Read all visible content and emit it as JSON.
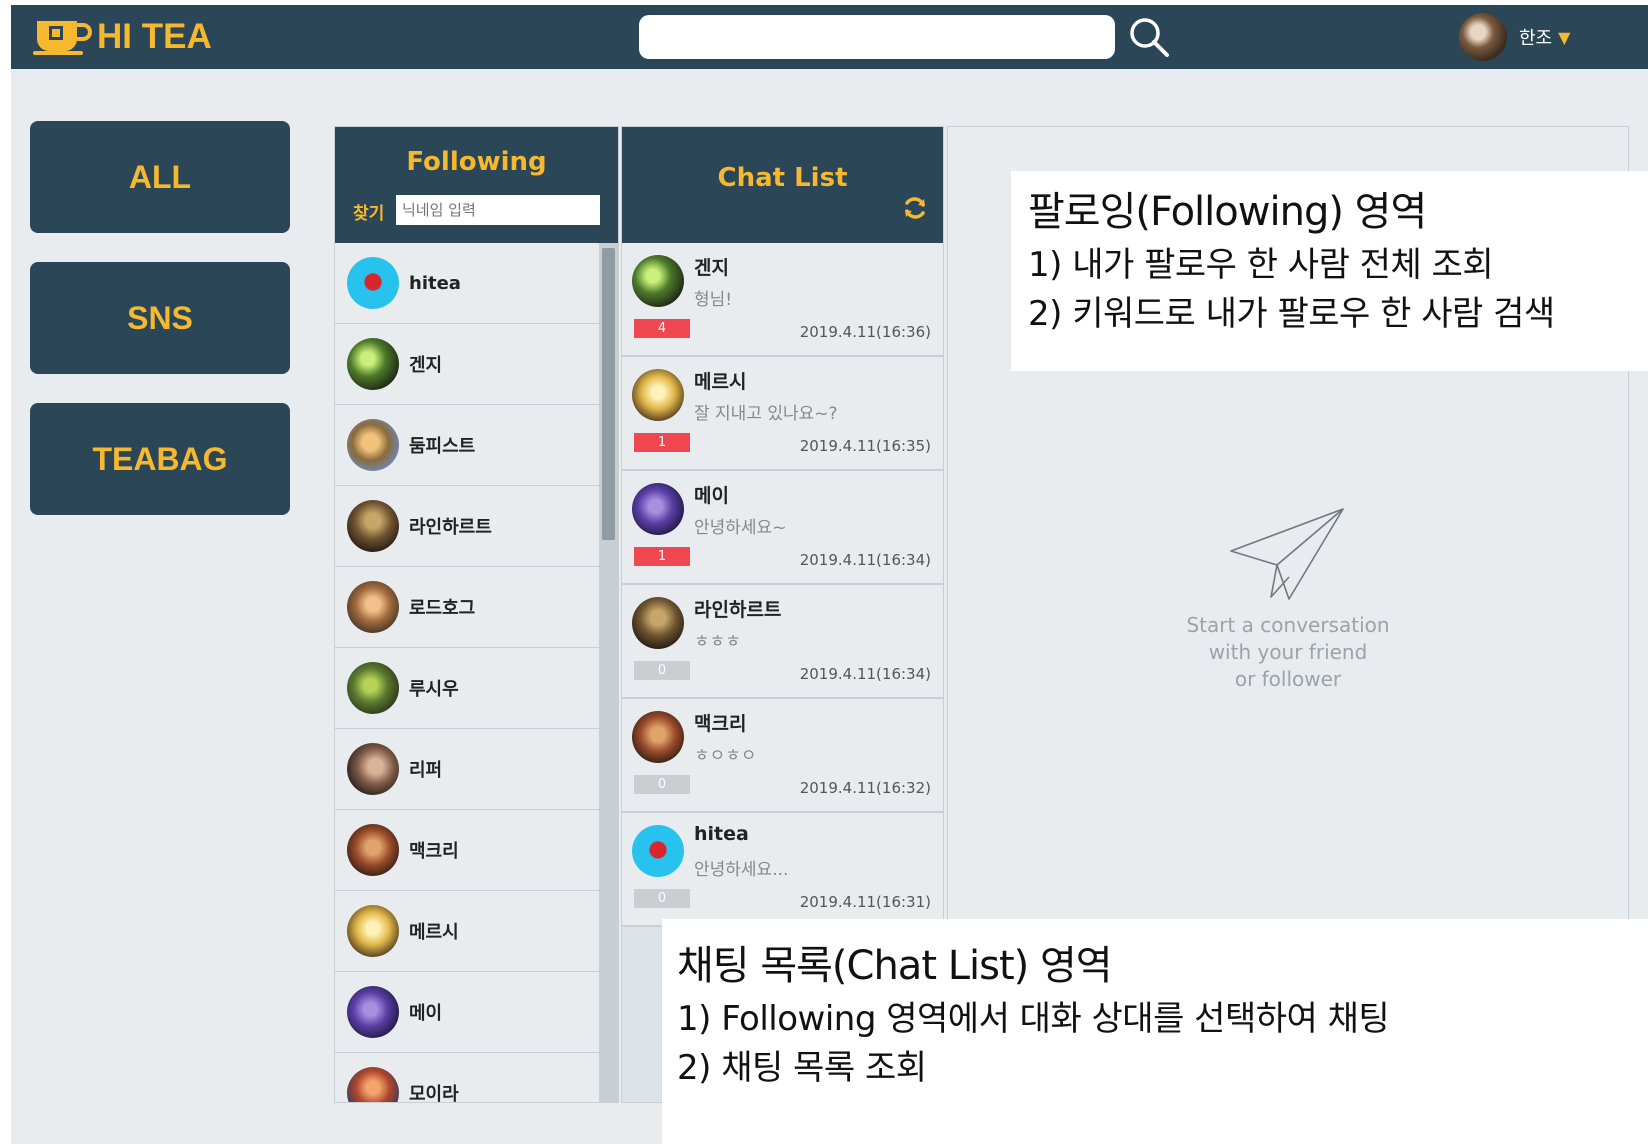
{
  "header": {
    "brand": "HI TEA",
    "search_placeholder": "",
    "user_name": "한조",
    "user_caret": "▼",
    "colors": {
      "bar": "#2a4657",
      "accent": "#f5b82e"
    }
  },
  "nav": {
    "items": [
      "ALL",
      "SNS",
      "TEABAG"
    ]
  },
  "following": {
    "title": "Following",
    "find_label": "찾기",
    "find_placeholder": "닉네임 입력",
    "users": [
      {
        "name": "hitea",
        "avatar": "hitea-avatar"
      },
      {
        "name": "겐지",
        "avatar": "genji-avatar"
      },
      {
        "name": "둠피스트",
        "avatar": "doomfist-avatar"
      },
      {
        "name": "라인하르트",
        "avatar": "reinhardt-avatar"
      },
      {
        "name": "로드호그",
        "avatar": "roadhog-avatar"
      },
      {
        "name": "루시우",
        "avatar": "lucio-avatar"
      },
      {
        "name": "리퍼",
        "avatar": "reaper-avatar"
      },
      {
        "name": "맥크리",
        "avatar": "mccree-avatar"
      },
      {
        "name": "메르시",
        "avatar": "mercy-avatar"
      },
      {
        "name": "메이",
        "avatar": "mei-avatar"
      },
      {
        "name": "모이라",
        "avatar": "moira-avatar"
      }
    ]
  },
  "chatlist": {
    "title": "Chat List",
    "chats": [
      {
        "name": "겐지",
        "message": "형님!",
        "unread": "4",
        "time": "2019.4.11(16:36)",
        "unread_style": "red"
      },
      {
        "name": "메르시",
        "message": "잘 지내고 있나요~?",
        "unread": "1",
        "time": "2019.4.11(16:35)",
        "unread_style": "red"
      },
      {
        "name": "메이",
        "message": "안녕하세요~",
        "unread": "1",
        "time": "2019.4.11(16:34)",
        "unread_style": "red"
      },
      {
        "name": "라인하르트",
        "message": "ㅎㅎㅎ",
        "unread": "0",
        "time": "2019.4.11(16:34)",
        "unread_style": "gray"
      },
      {
        "name": "맥크리",
        "message": "ㅎㅇㅎㅇ",
        "unread": "0",
        "time": "2019.4.11(16:32)",
        "unread_style": "gray"
      },
      {
        "name": "hitea",
        "message": "안녕하세요...",
        "unread": "0",
        "time": "2019.4.11(16:31)",
        "unread_style": "gray"
      }
    ]
  },
  "chatarea": {
    "empty_text": "Start a conversation\nwith your friend\nor follower"
  },
  "annotations": {
    "following_note": {
      "title": "팔로잉(Following) 영역",
      "line1": "1) 내가 팔로우 한 사람 전체 조회",
      "line2": "2) 키워드로 내가 팔로우 한 사람 검색"
    },
    "chatlist_note": {
      "title": "채팅 목록(Chat List) 영역",
      "line1": "1) Following 영역에서 대화 상대를 선택하여 채팅",
      "line2": "2) 채팅 목록 조회"
    }
  }
}
